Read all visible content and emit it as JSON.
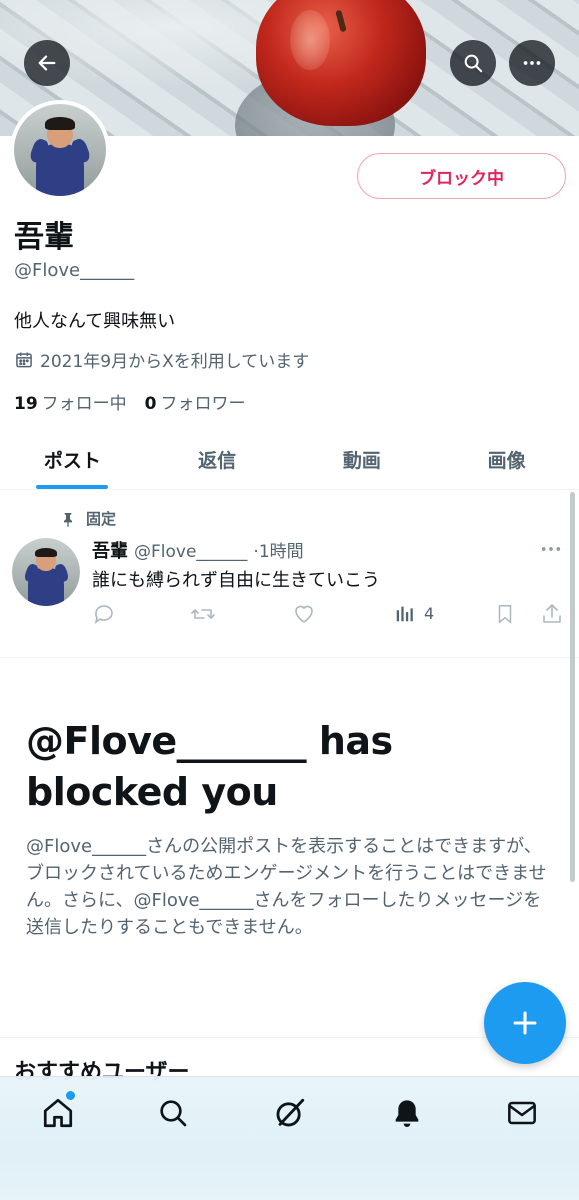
{
  "header": {
    "back_icon": "arrow-left-icon",
    "search_icon": "search-icon",
    "more_icon": "more-horizontal-icon"
  },
  "profile": {
    "block_button_label": "ブロック中",
    "display_name": "吾輩",
    "handle": "@Flove______",
    "bio": "他人なんて興味無い",
    "joined": "2021年9月からXを利用しています",
    "following_count": "19",
    "following_label": "フォロー中",
    "followers_count": "0",
    "followers_label": "フォロワー"
  },
  "tabs": [
    {
      "label": "ポスト",
      "active": true
    },
    {
      "label": "返信",
      "active": false
    },
    {
      "label": "動画",
      "active": false
    },
    {
      "label": "画像",
      "active": false
    }
  ],
  "pinned_post": {
    "pinned_label": "固定",
    "author_name": "吾輩",
    "author_handle": "@Flove______",
    "time": "·1時間",
    "text": "誰にも縛られず自由に生きていこう",
    "views": "4"
  },
  "block_notice": {
    "title": "@Flove_______ has blocked you",
    "description": "@Flove______さんの公開ポストを表示することはできますが、ブロックされているためエンゲージメントを行うことはできません。さらに、@Flove______さんをフォローしたりメッセージを送信したりすることもできません。"
  },
  "recommend_title": "おすすめユーザー",
  "colors": {
    "accent": "#1d9bf0",
    "block_red": "#e0245e",
    "muted_text": "#536471"
  }
}
